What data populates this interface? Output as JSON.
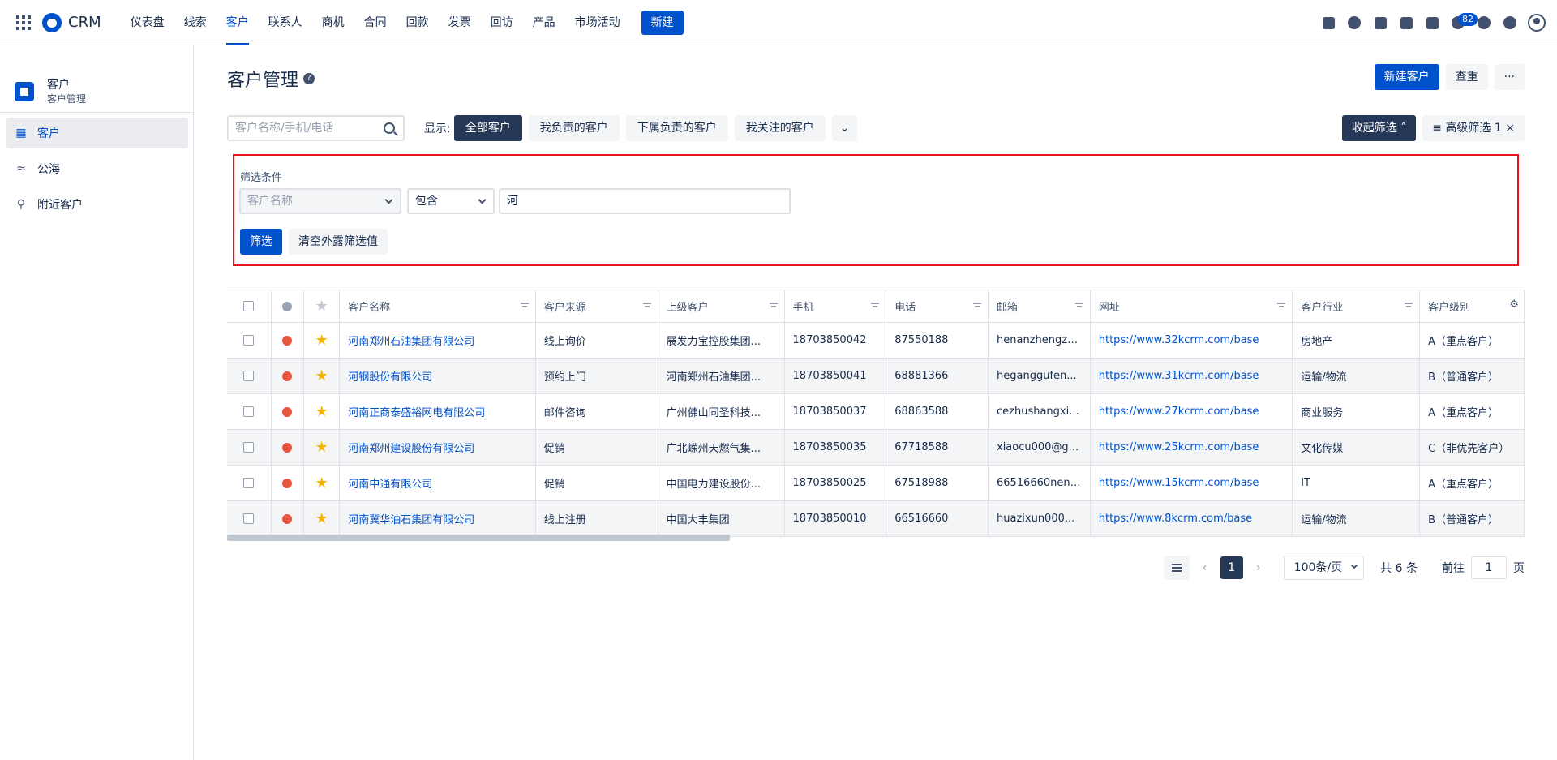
{
  "app": {
    "title": "CRM"
  },
  "nav": {
    "items": [
      "仪表盘",
      "线索",
      "客户",
      "联系人",
      "商机",
      "合同",
      "回款",
      "发票",
      "回访",
      "产品",
      "市场活动"
    ],
    "active_index": 2,
    "new_label": "新建"
  },
  "notifications": {
    "count": "82"
  },
  "sidebar": {
    "title": "客户",
    "subtitle": "客户管理",
    "items": [
      {
        "label": "客户",
        "icon": "building-icon"
      },
      {
        "label": "公海",
        "icon": "waves-icon"
      },
      {
        "label": "附近客户",
        "icon": "location-pin-icon"
      }
    ]
  },
  "page": {
    "title": "客户管理",
    "new_customer_label": "新建客户",
    "dedupe_label": "查重",
    "more_label": "···"
  },
  "toolbar": {
    "search_placeholder": "客户名称/手机/电话",
    "display_label": "显示:",
    "segments": [
      "全部客户",
      "我负责的客户",
      "下属负责的客户",
      "我关注的客户"
    ],
    "collapse_label": "收起筛选",
    "advanced_label": "高级筛选",
    "advanced_count": "1"
  },
  "filter": {
    "label": "筛选条件",
    "field": "客户名称",
    "operator": "包含",
    "value": "河",
    "apply_label": "筛选",
    "clear_label": "清空外露筛选值"
  },
  "table": {
    "columns": [
      "客户名称",
      "客户来源",
      "上级客户",
      "手机",
      "电话",
      "邮箱",
      "网址",
      "客户行业",
      "客户级别"
    ],
    "rows": [
      [
        "河南郑州石油集团有限公司",
        "线上询价",
        "展发力宝控股集团...",
        "18703850042",
        "87550188",
        "henanzhengzh...",
        "https://www.32kcrm.com/base",
        "房地产",
        "A（重点客户）"
      ],
      [
        "河钢股份有限公司",
        "预约上门",
        "河南郑州石油集团...",
        "18703850041",
        "68881366",
        "heganggufen...",
        "https://www.31kcrm.com/base",
        "运输/物流",
        "B（普通客户）"
      ],
      [
        "河南正商泰盛裕网电有限公司",
        "邮件咨询",
        "广州佛山同圣科技...",
        "18703850037",
        "68863588",
        "cezhushangxi...",
        "https://www.27kcrm.com/base",
        "商业服务",
        "A（重点客户）"
      ],
      [
        "河南郑州建设股份有限公司",
        "促销",
        "广北嵘州天燃气集...",
        "18703850035",
        "67718588",
        "xiaocu000@g...",
        "https://www.25kcrm.com/base",
        "文化传媒",
        "C（非优先客户）"
      ],
      [
        "河南中通有限公司",
        "促销",
        "中国电力建设股份...",
        "18703850025",
        "67518988",
        "66516660neng...",
        "https://www.15kcrm.com/base",
        "IT",
        "A（重点客户）"
      ],
      [
        "河南冀华油石集团有限公司",
        "线上注册",
        "中国大丰集团",
        "18703850010",
        "66516660",
        "huazixun000...",
        "https://www.8kcrm.com/base",
        "运输/物流",
        "B（普通客户）"
      ]
    ]
  },
  "pagination": {
    "current": "1",
    "page_size": "100条/页",
    "total": "共 6 条",
    "goto_label": "前往",
    "goto_value": "1",
    "page_suffix": "页"
  },
  "colors": {
    "primary": "#0052cc",
    "dark": "#253858",
    "highlight_border": "#e8141b",
    "star": "#f5b400"
  }
}
